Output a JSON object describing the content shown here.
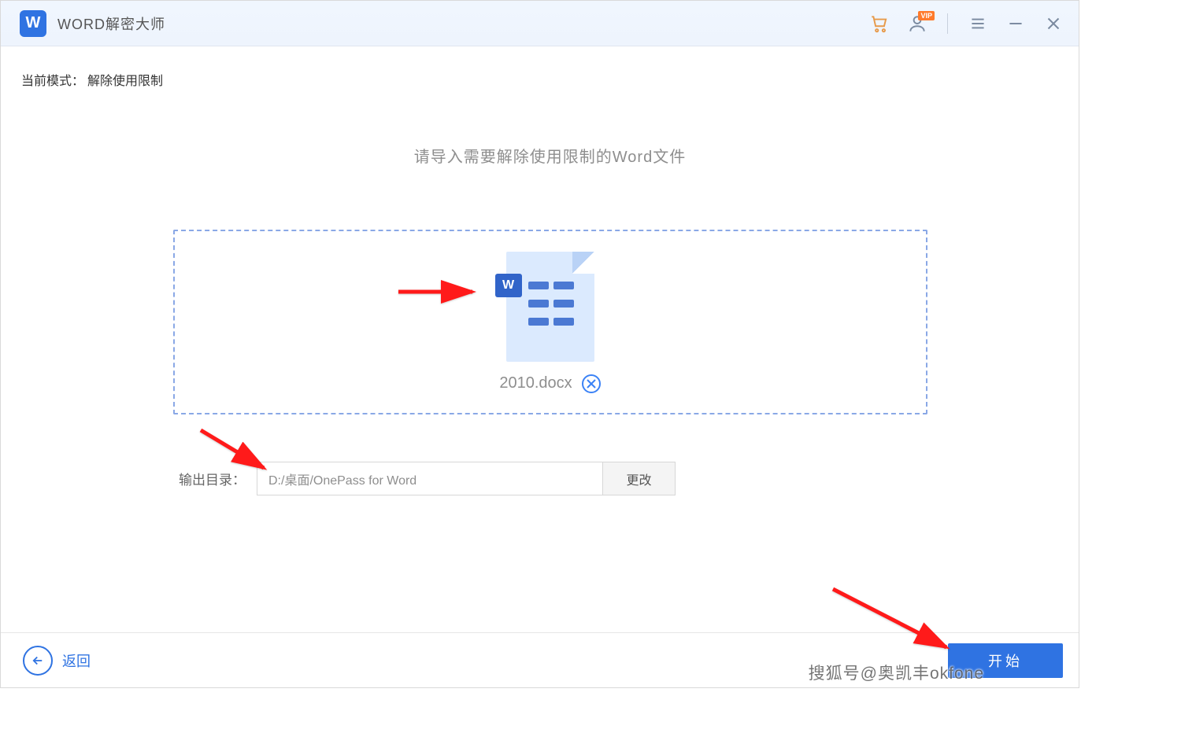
{
  "titlebar": {
    "app_title": "WORD解密大师",
    "logo_letter": "W",
    "vip_badge": "VIP"
  },
  "content": {
    "mode_label": "当前模式：",
    "mode_value": "解除使用限制",
    "instruction": "请导入需要解除使用限制的Word文件",
    "file": {
      "name": "2010.docx",
      "icon_letter": "W"
    },
    "output": {
      "label": "输出目录：",
      "path": "D:/桌面/OnePass for Word",
      "change_label": "更改"
    }
  },
  "footer": {
    "back_label": "返回",
    "start_label": "开始"
  },
  "watermark": "搜狐号@奥凯丰okfone",
  "colors": {
    "primary": "#2f73e2",
    "accent": "#ff7a2b",
    "drop_border": "#8aa8e6"
  }
}
